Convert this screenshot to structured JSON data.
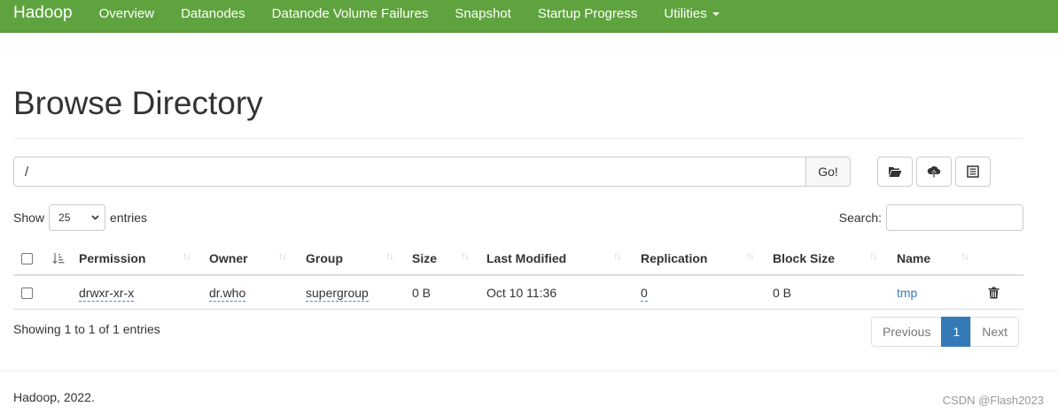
{
  "nav": {
    "brand": "Hadoop",
    "items": [
      "Overview",
      "Datanodes",
      "Datanode Volume Failures",
      "Snapshot",
      "Startup Progress",
      "Utilities"
    ]
  },
  "header": {
    "title": "Browse Directory"
  },
  "path": {
    "value": "/",
    "go_label": "Go!"
  },
  "toolbar": {
    "icons": [
      "folder-open-icon",
      "upload-icon",
      "list-icon"
    ]
  },
  "table_controls": {
    "show_label": "Show",
    "entries_value": "25",
    "entries_label": "entries",
    "search_label": "Search:"
  },
  "table": {
    "columns": [
      "Permission",
      "Owner",
      "Group",
      "Size",
      "Last Modified",
      "Replication",
      "Block Size",
      "Name"
    ],
    "rows": [
      {
        "permission": "drwxr-xr-x",
        "owner": "dr.who",
        "group": "supergroup",
        "size": "0 B",
        "last_modified": "Oct 10 11:36",
        "replication": "0",
        "block_size": "0 B",
        "name": "tmp"
      }
    ]
  },
  "pagination": {
    "info": "Showing 1 to 1 of 1 entries",
    "previous": "Previous",
    "current": "1",
    "next": "Next"
  },
  "footer": {
    "text": "Hadoop, 2022."
  },
  "watermark": "CSDN @Flash2023",
  "colors": {
    "navbar": "#5fa33e",
    "link": "#337ab7",
    "active_page": "#337ab7"
  }
}
